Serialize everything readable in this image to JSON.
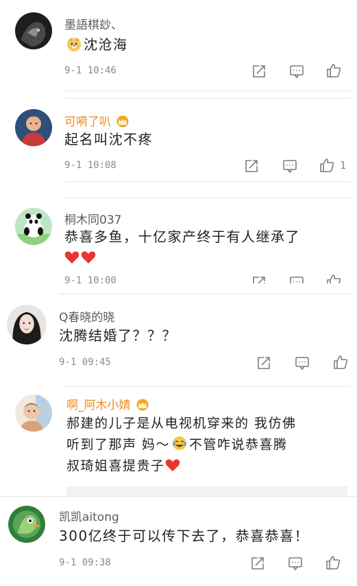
{
  "comments": [
    {
      "username": "墨語棋玅、",
      "vip": false,
      "text_lines": [
        "沈沧海"
      ],
      "time": "9-1 10:46",
      "likes": ""
    },
    {
      "username": "可嗬了叭",
      "vip": true,
      "text_lines": [
        "起名叫沈不疼"
      ],
      "time": "9-1 10:08",
      "likes": "1"
    },
    {
      "username": "桐木同037",
      "vip": false,
      "text_lines": [
        "恭喜多鱼，十亿家产终于有人继承了"
      ],
      "time": "9-1 10:00",
      "likes": ""
    },
    {
      "username": "Q春晓的晓",
      "vip": false,
      "text_lines": [
        "沈腾结婚了？？？"
      ],
      "time": "9-1 09:45",
      "likes": ""
    },
    {
      "username": "啊_阿木小婧",
      "vip": true,
      "text_lines": [
        "郝建的儿子是从电视机穿来的 我仿佛",
        "听到了那声 妈～",
        "不管咋说恭喜腾",
        "叔琦姐喜提贵子"
      ],
      "time": "",
      "likes": ""
    },
    {
      "username": "凯凯aitong",
      "vip": false,
      "text_lines": [
        "300亿终于可以传下去了，恭喜恭喜！"
      ],
      "time": "9-1 09:38",
      "likes": ""
    }
  ],
  "icons": {
    "share": "share-icon",
    "reply": "comment-icon",
    "like": "thumbs-up-icon",
    "vip": "crown-icon"
  },
  "colors": {
    "vip_name": "#f08a1e",
    "heart": "#e8362f",
    "icon_gray": "#7c7c7c"
  }
}
